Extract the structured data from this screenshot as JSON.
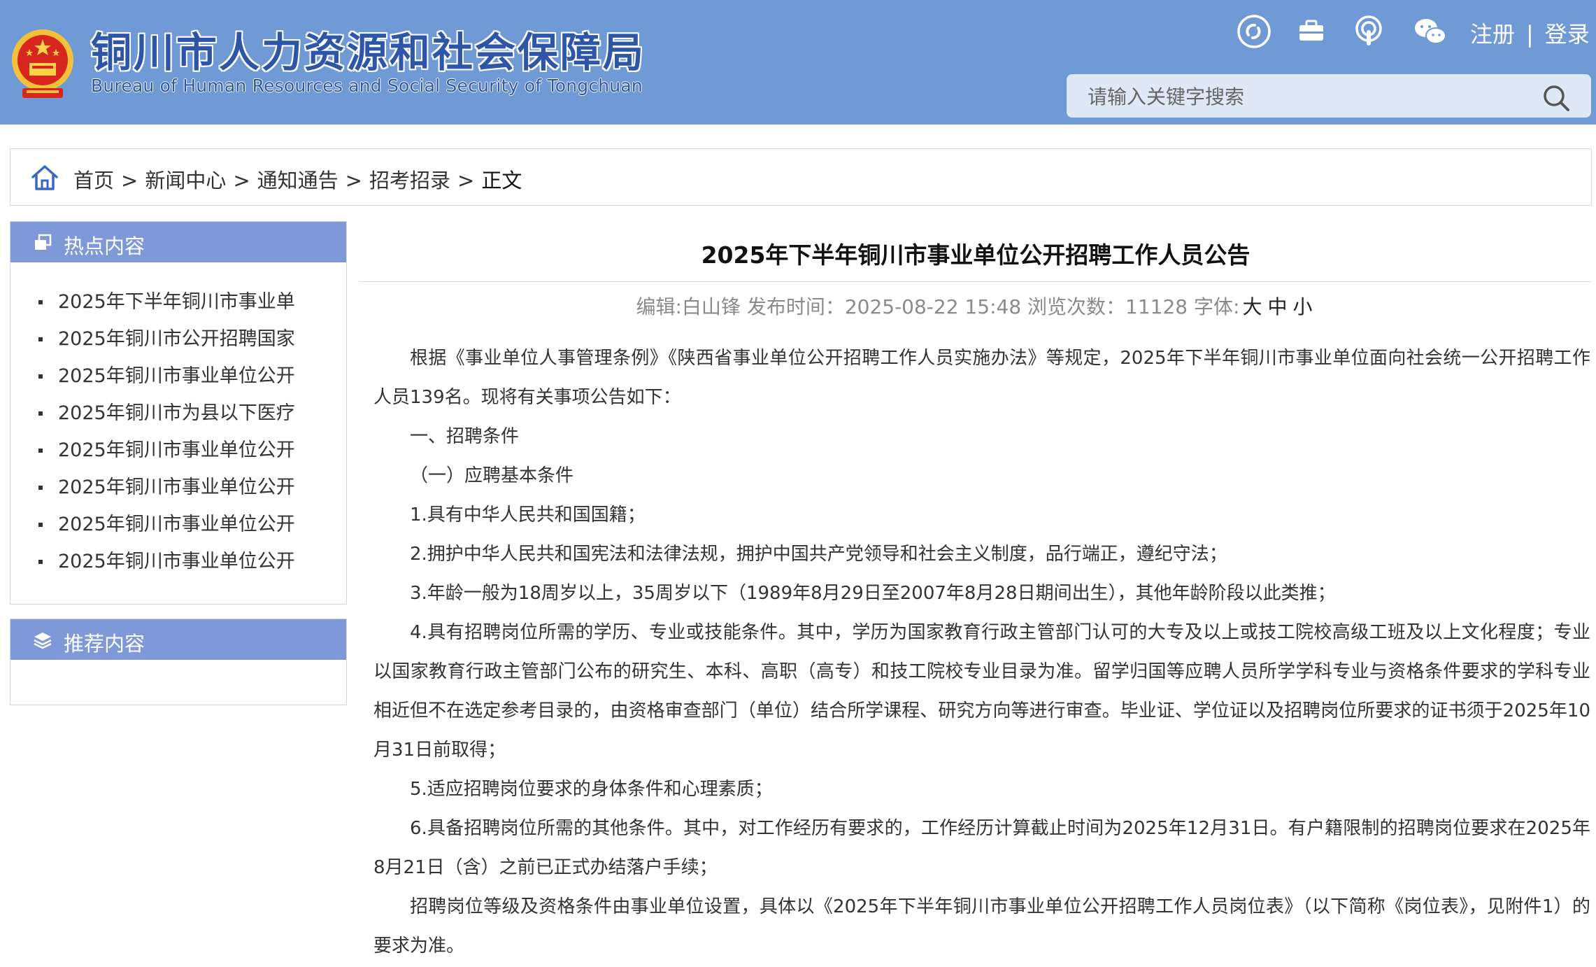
{
  "header": {
    "title": "铜川市人力资源和社会保障局",
    "subtitle": "Bureau of Human Resources and Social Security of Tongchuan",
    "register": "注册",
    "separator": "|",
    "login": "登录",
    "icons": [
      "weibo-icon",
      "briefcase-icon",
      "podcast-icon",
      "wechat-icon"
    ],
    "search_placeholder": "请输入关键字搜索"
  },
  "breadcrumb": {
    "items": [
      "首页",
      "新闻中心",
      "通知通告",
      "招考招录",
      "正文"
    ],
    "arrow": ">"
  },
  "sidebar": {
    "hot": {
      "title": "热点内容",
      "items": [
        "2025年下半年铜川市事业单",
        "2025年铜川市公开招聘国家",
        "2025年铜川市事业单位公开",
        "2025年铜川市为县以下医疗",
        "2025年铜川市事业单位公开",
        "2025年铜川市事业单位公开",
        "2025年铜川市事业单位公开",
        "2025年铜川市事业单位公开"
      ]
    },
    "recommend": {
      "title": "推荐内容"
    }
  },
  "article": {
    "title": "2025年下半年铜川市事业单位公开招聘工作人员公告",
    "meta": "编辑:白山锋 发布时间：2025-08-22 15:48 浏览次数：11128 字体:",
    "font_sizes": [
      "大",
      "中",
      "小"
    ],
    "paragraphs": [
      "根据《事业单位人事管理条例》《陕西省事业单位公开招聘工作人员实施办法》等规定，2025年下半年铜川市事业单位面向社会统一公开招聘工作人员139名。现将有关事项公告如下：",
      "一、招聘条件",
      "（一）应聘基本条件",
      "1.具有中华人民共和国国籍；",
      "2.拥护中华人民共和国宪法和法律法规，拥护中国共产党领导和社会主义制度，品行端正，遵纪守法；",
      "3.年龄一般为18周岁以上，35周岁以下（1989年8月29日至2007年8月28日期间出生），其他年龄阶段以此类推；",
      "4.具有招聘岗位所需的学历、专业或技能条件。其中，学历为国家教育行政主管部门认可的大专及以上或技工院校高级工班及以上文化程度；专业以国家教育行政主管部门公布的研究生、本科、高职（高专）和技工院校专业目录为准。留学归国等应聘人员所学学科专业与资格条件要求的学科专业相近但不在选定参考目录的，由资格审查部门（单位）结合所学课程、研究方向等进行审查。毕业证、学位证以及招聘岗位所要求的证书须于2025年10月31日前取得；",
      "5.适应招聘岗位要求的身体条件和心理素质；",
      "6.具备招聘岗位所需的其他条件。其中，对工作经历有要求的，工作经历计算截止时间为2025年12月31日。有户籍限制的招聘岗位要求在2025年8月21日（含）之前已正式办结落户手续；",
      "招聘岗位等级及资格条件由事业单位设置，具体以《2025年下半年铜川市事业单位公开招聘工作人员岗位表》（以下简称《岗位表》，见附件1）的要求为准。"
    ]
  },
  "colors": {
    "header_bg": "#6f9ad6",
    "panel_head_bg": "#7e98d8",
    "title_blue": "#2e56a8"
  }
}
